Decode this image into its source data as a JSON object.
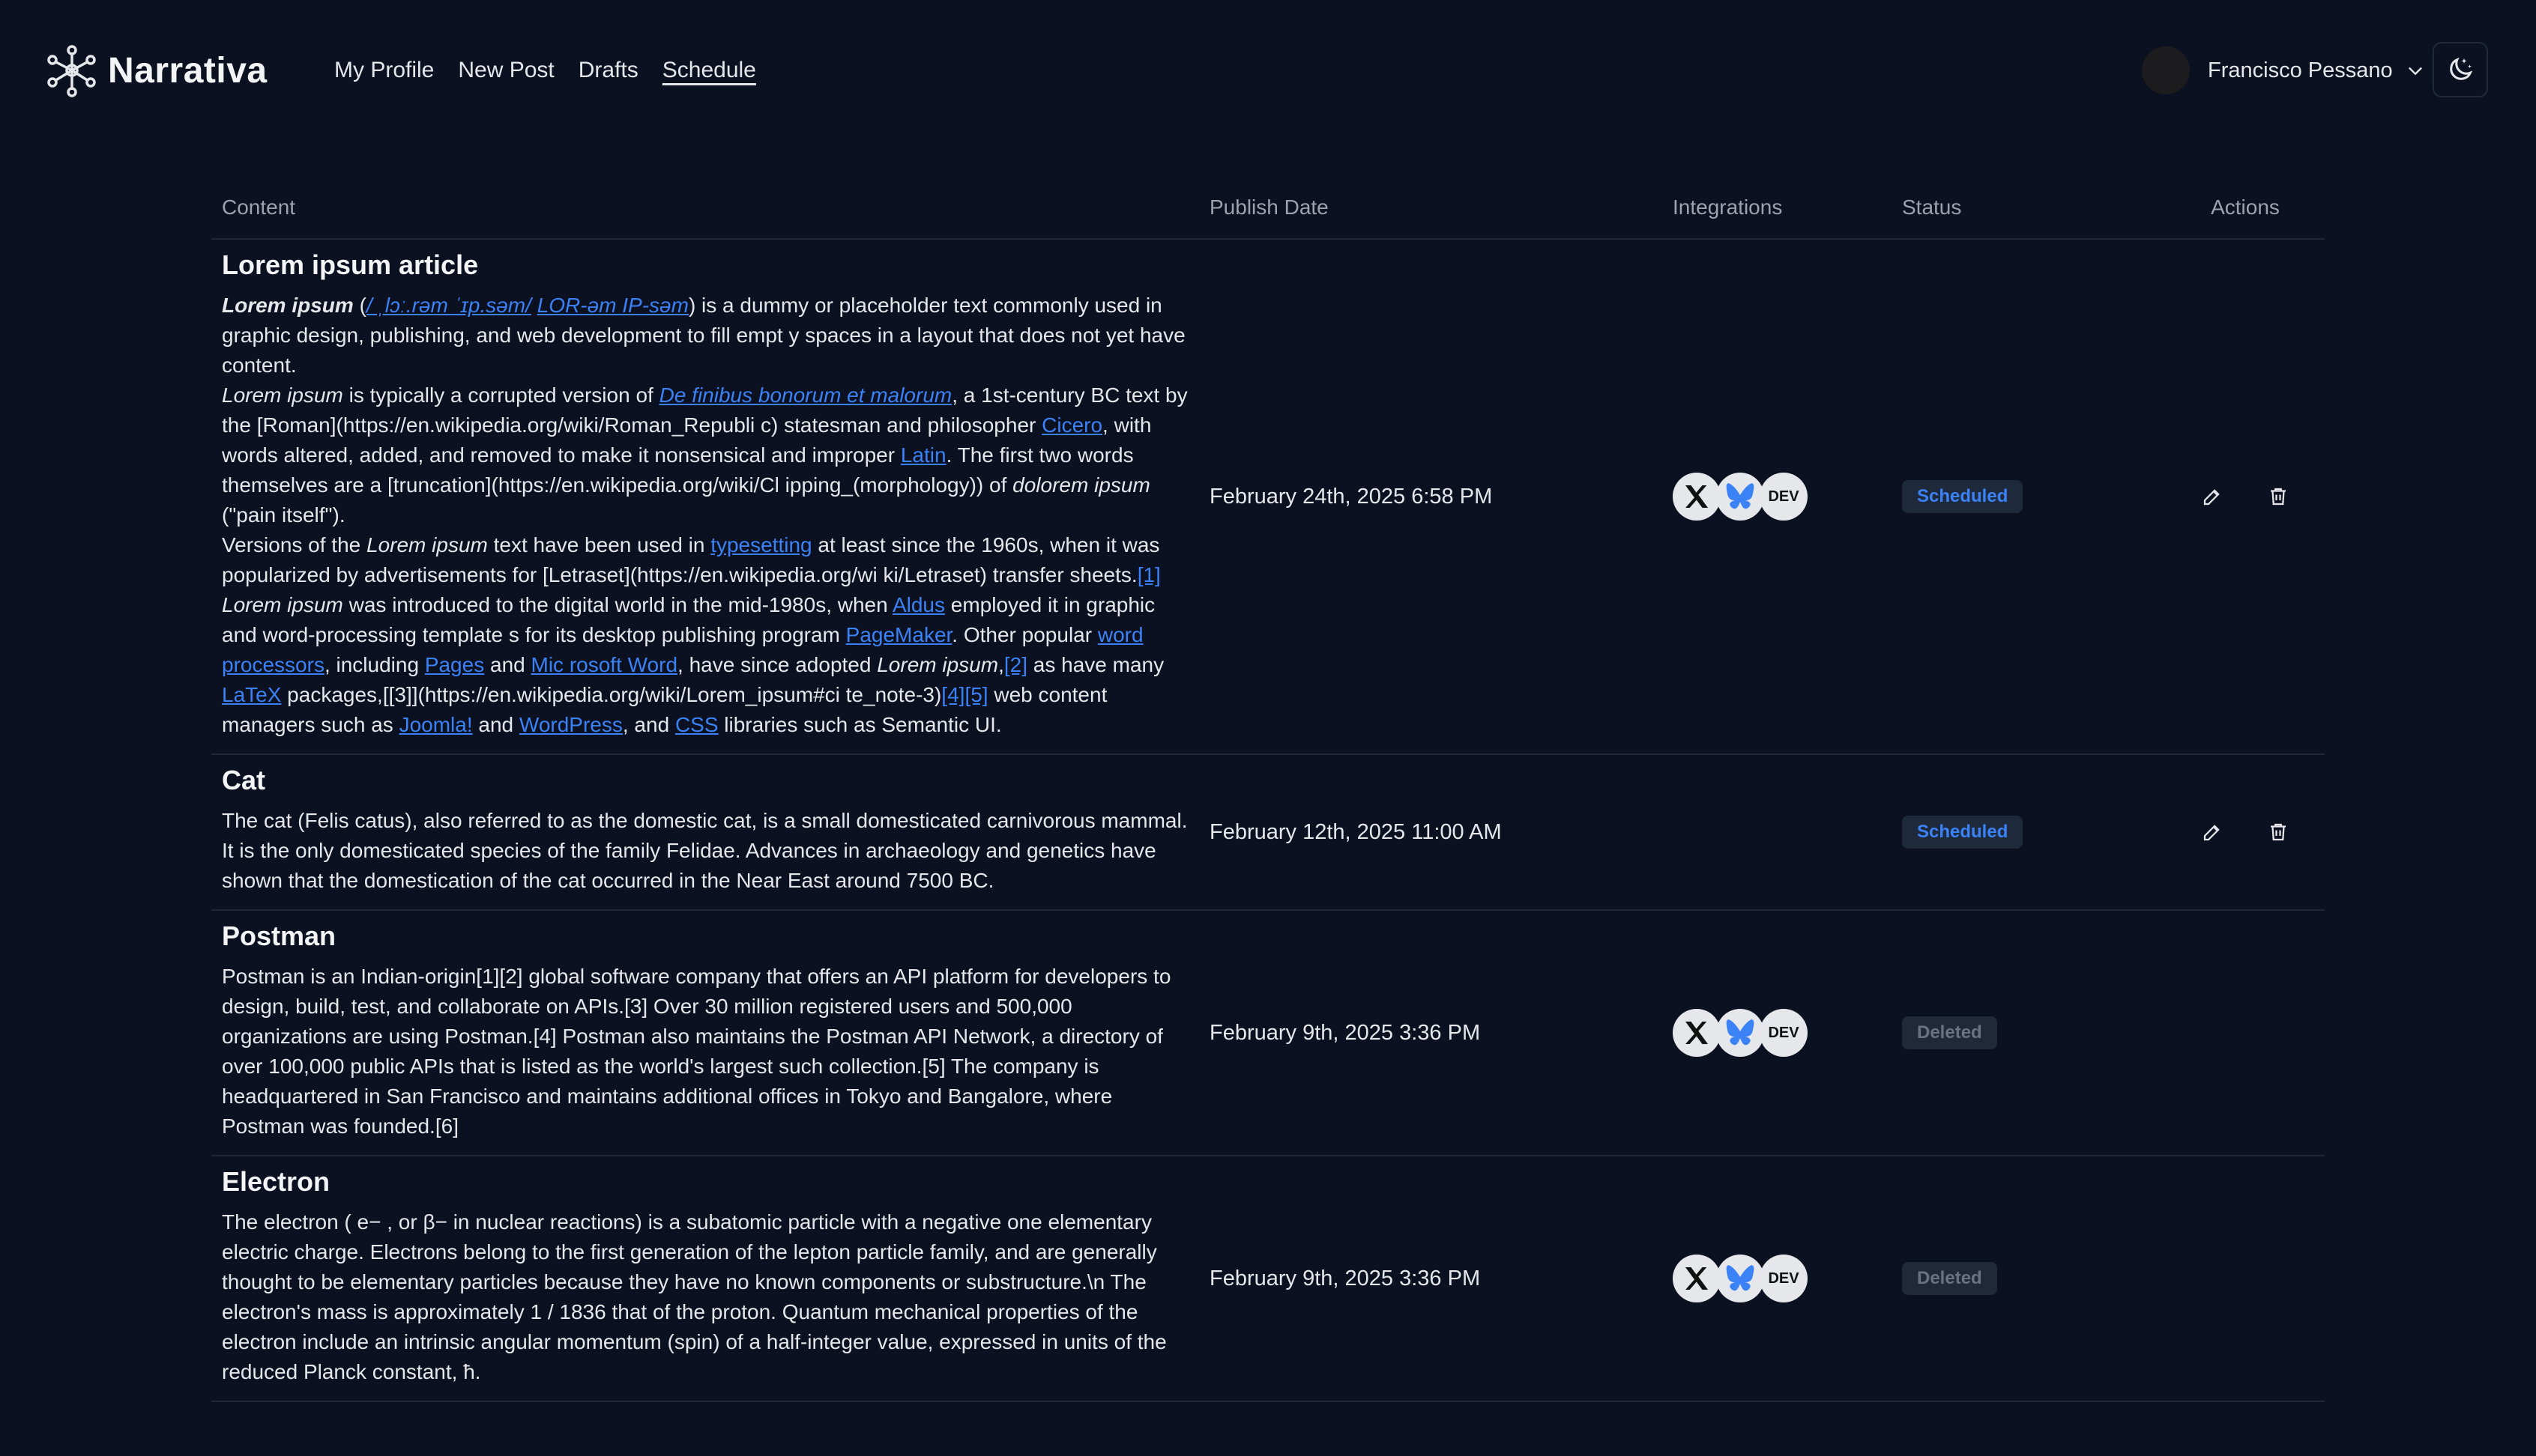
{
  "app": {
    "name": "Narrativa"
  },
  "nav": [
    {
      "label": "My Profile",
      "active": false
    },
    {
      "label": "New Post",
      "active": false
    },
    {
      "label": "Drafts",
      "active": false
    },
    {
      "label": "Schedule",
      "active": true
    }
  ],
  "user": {
    "name": "Francisco Pessano"
  },
  "table": {
    "headers": {
      "content": "Content",
      "date": "Publish Date",
      "integrations": "Integrations",
      "status": "Status",
      "actions": "Actions"
    },
    "rows": [
      {
        "title": "Lorem ipsum article",
        "date": "February 24th, 2025 6:58 PM",
        "integrations": [
          "x-icon",
          "bluesky-icon",
          "dev-icon"
        ],
        "status": "Scheduled",
        "actions": [
          "edit-icon",
          "trash-icon"
        ]
      },
      {
        "title": "Cat",
        "body": "The cat (Felis catus), also referred to as the domestic cat, is a small domesticated carnivorous mammal. It is the only domesticated species of the family Felidae. Advances in archaeology and genetics have shown that the domestication of the cat occurred in the Near East around 7500 BC.",
        "date": "February 12th, 2025 11:00 AM",
        "integrations": [],
        "status": "Scheduled",
        "actions": [
          "edit-icon",
          "trash-icon"
        ]
      },
      {
        "title": "Postman",
        "body": "Postman is an Indian-origin[1][2] global software company that offers an API platform for developers to design, build, test, and collaborate on APIs.[3] Over 30 million registered users and 500,000 organizations are using Postman.[4] Postman also maintains the Postman API Network, a directory of over 100,000 public APIs that is listed as the world's largest such collection.[5] The company is headquartered in San Francisco and maintains additional offices in Tokyo and Bangalore, where Postman was founded.[6]",
        "date": "February 9th, 2025 3:36 PM",
        "integrations": [
          "x-icon",
          "bluesky-icon",
          "dev-icon"
        ],
        "status": "Deleted",
        "actions": []
      },
      {
        "title": "Electron",
        "body": "The electron ( e− , or β− in nuclear reactions) is a subatomic particle with a negative one elementary electric charge. Electrons belong to the first generation of the lepton particle family, and are generally thought to be elementary particles because they have no known components or substructure.\\n The electron's mass is approximately  1 / 1836  that of the proton. Quantum mechanical properties of the electron include an intrinsic angular momentum (spin) of a half-integer value, expressed in units of the reduced Planck constant, ħ.",
        "date": "February 9th, 2025 3:36 PM",
        "integrations": [
          "x-icon",
          "bluesky-icon",
          "dev-icon"
        ],
        "status": "Deleted",
        "actions": []
      }
    ]
  },
  "lorem": {
    "p1": {
      "a": "Lorem ipsum",
      "b": " (",
      "c": "/ ˌlɔː.rəm ˈɪp.səm/",
      "d": " ",
      "e": "LOR-əm IP-səm",
      "f": ") is a dummy or placeholder text commonly used in graphic design, publishing, and web development to fill empt y spaces in a layout that does not yet have content."
    },
    "p2": {
      "a": "Lorem ipsum",
      "b": " is typically a corrupted version of ",
      "c": "De finibus bonorum et malorum",
      "d": ", a 1st-century BC text by the [Roman](https://en.wikipedia.org/wiki/Roman_Republi c) statesman and philosopher ",
      "e": "Cicero",
      "f": ", with words altered, added, and removed to make it nonsensical and improper ",
      "g": "Latin",
      "h": ". The first two words themselves are a [truncation](https://en.wikipedia.org/wiki/Cl ipping_(morphology)) of ",
      "i": "dolorem ipsum",
      "j": " (\"pain itself\")."
    },
    "p3": {
      "a": "Versions of the ",
      "b": "Lorem ipsum",
      "c": " text have been used in ",
      "d": "typesetting",
      "e": " at least since the 1960s, when it was popularized by advertisements for [Letraset](https://en.wikipedia.org/wi ki/Letraset) transfer sheets.",
      "f": "[1]",
      "g": " ",
      "h": "Lorem ipsum",
      "i": " was introduced to the digital world in the mid-1980s, when ",
      "j": "Aldus",
      "k": " employed it in graphic and word-processing template s for its desktop publishing program ",
      "l": "PageMaker",
      "m": ". Other popular ",
      "n": "word processors",
      "o": ", including ",
      "p": "Pages",
      "q": " and ",
      "r": "Mic rosoft Word",
      "s": ", have since adopted ",
      "t": "Lorem ipsum",
      "u": ",",
      "v": "[2]",
      "w": " as have many ",
      "x": "LaTeX",
      "y": " packages,[[3]](https://en.wikipedia.org/wiki/Lorem_ipsum#ci te_note-3)",
      "z": "[4]",
      "aa": "[5]",
      "ab": " web content managers such as ",
      "ac": "Joomla!",
      "ad": " and ",
      "ae": "WordPress",
      "af": ", and ",
      "ag": "CSS",
      "ah": " libraries such as Semantic UI."
    }
  },
  "colors": {
    "background": "#0b1120",
    "link": "#3b82f6",
    "scheduled": "#3b82f6",
    "deleted": "#6b7280"
  }
}
